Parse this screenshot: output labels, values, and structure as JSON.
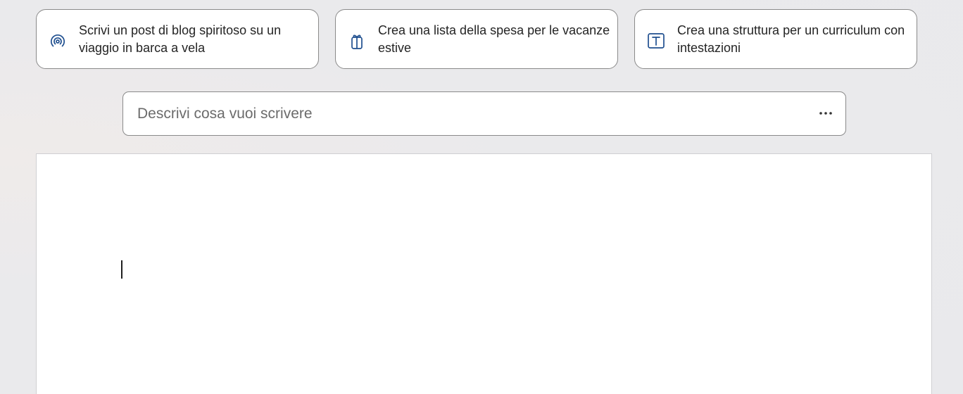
{
  "suggestions": [
    {
      "icon": "broadcast-icon",
      "text": "Scrivi un post di blog spiritoso su un viaggio in barca a vela"
    },
    {
      "icon": "gift-icon",
      "text": "Crea una lista della spesa per le vacanze estive"
    },
    {
      "icon": "text-box-icon",
      "text": "Crea una struttura per un curriculum con intestazioni"
    }
  ],
  "prompt": {
    "placeholder": "Descrivi cosa vuoi scrivere",
    "value": "",
    "more_icon": "more-horizontal-icon"
  },
  "colors": {
    "icon_blue": "#1f4f8f",
    "border": "#8a8a8a",
    "page_background": "#e9e9ec"
  }
}
